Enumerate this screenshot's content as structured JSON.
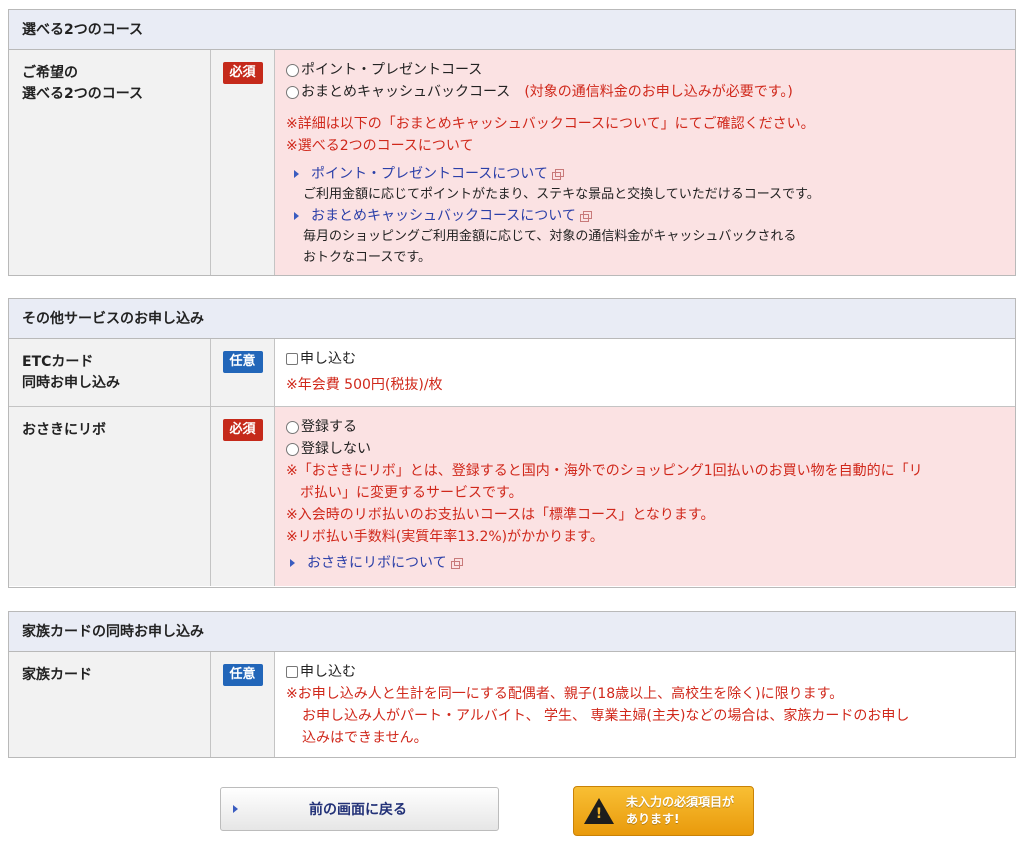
{
  "section_course": {
    "title": "選べる2つのコース",
    "label_line1": "ご希望の",
    "label_line2": "選べる2つのコース",
    "badge": "必須",
    "option1": "ポイント・プレゼントコース",
    "option2": "おまとめキャッシュバックコース",
    "option2_note": "(対象の通信料金のお申し込みが必要です。)",
    "note1": "※詳細は以下の「おまとめキャッシュバックコースについて」にてご確認ください。",
    "note2": "※選べる2つのコースについて",
    "link1": "ポイント・プレゼントコースについて",
    "desc1": "ご利用金額に応じてポイントがたまり、ステキな景品と交換していただけるコースです。",
    "link2": "おまとめキャッシュバックコースについて",
    "desc2_line1": "毎月のショッピングご利用金額に応じて、対象の通信料金がキャッシュバックされる",
    "desc2_line2": "おトクなコースです。"
  },
  "section_other": {
    "title": "その他サービスのお申し込み",
    "etc_label_line1": "ETCカード",
    "etc_label_line2": "同時お申し込み",
    "etc_badge": "任意",
    "etc_option": "申し込む",
    "etc_note": "※年会費 500円(税抜)/枚",
    "revo_label": "おさきにリボ",
    "revo_badge": "必須",
    "revo_option1": "登録する",
    "revo_option2": "登録しない",
    "revo_note1_line1": "※「おさきにリボ」とは、登録すると国内・海外でのショッピング1回払いのお買い物を自動的に「リ",
    "revo_note1_line2": "ボ払い」に変更するサービスです。",
    "revo_note2": "※入会時のリボ払いのお支払いコースは「標準コース」となります。",
    "revo_note3": "※リボ払い手数料(実質年率13.2%)がかかります。",
    "revo_link": "おさきにリボについて"
  },
  "section_family": {
    "title": "家族カードの同時お申し込み",
    "label": "家族カード",
    "badge": "任意",
    "option": "申し込む",
    "note1": "※お申し込み人と生計を同一にする配偶者、親子(18歳以上、高校生を除く)に限ります。",
    "note2_line1": "お申し込み人がパート・アルバイト、 学生、 専業主婦(主夫)などの場合は、家族カードのお申し",
    "note2_line2": "込みはできません。"
  },
  "buttons": {
    "back": "前の画面に戻る",
    "submit_line1": "未入力の必須項目が",
    "submit_line2": "あります!",
    "warn_glyph": "!"
  },
  "colors": {
    "required_badge": "#c52a1b",
    "optional_badge": "#2266b9",
    "note_red": "#d0281b",
    "link_blue": "#2b3fa8",
    "required_row_bg": "#fbe2e3",
    "section_header_bg": "#e9ecf5",
    "submit_button": "#f2ad22"
  }
}
